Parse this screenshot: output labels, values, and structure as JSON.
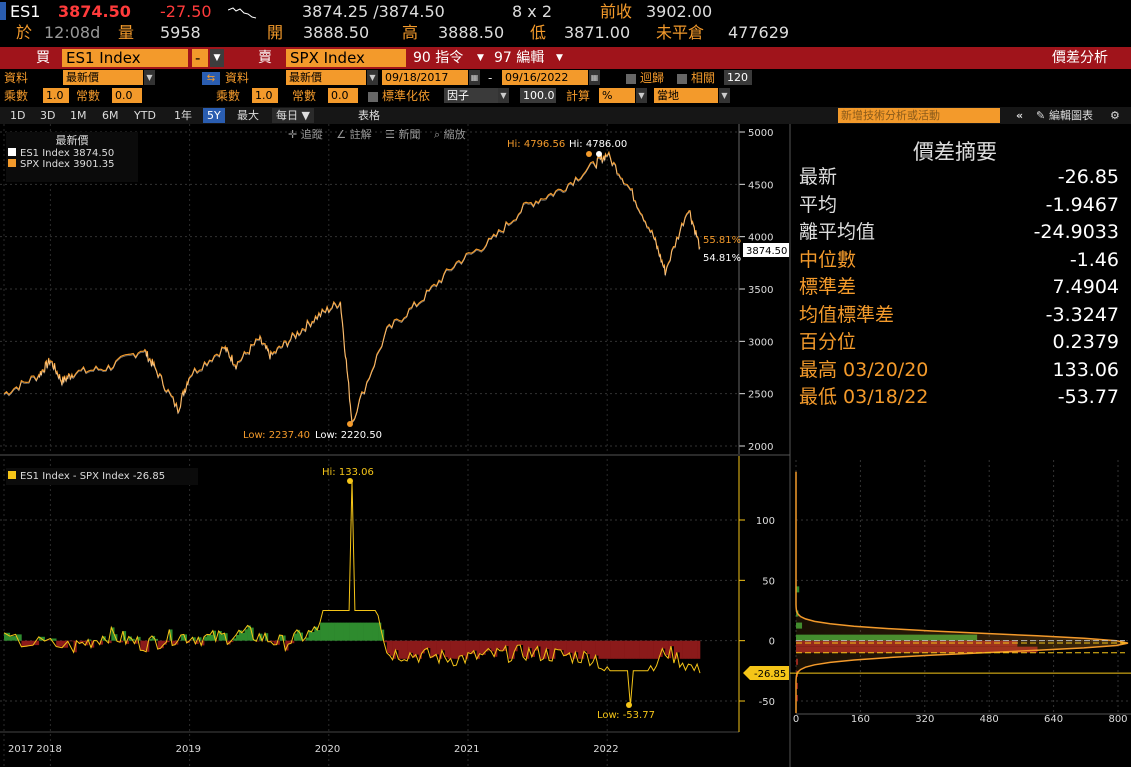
{
  "quote": {
    "ticker": "ES1",
    "last": "3874.50",
    "change": "-27.50",
    "bid_ask": "3874.25 /3874.50",
    "size": "8 x 2",
    "prev_close_label": "前收",
    "prev_close": "3902.00",
    "at_label": "於",
    "time": "12:08d",
    "volume_label": "量",
    "volume": "5958",
    "open_label": "開",
    "open": "3888.50",
    "high_label": "高",
    "high": "3888.50",
    "low_label": "低",
    "low": "3871.00",
    "oi_label": "未平倉",
    "open_interest": "477629"
  },
  "security_bar": {
    "buy_label": "買",
    "buy_security": "ES1 Index",
    "minus": "-",
    "sell_label": "賣",
    "sell_security": "SPX Index",
    "cmd1": "90 指令",
    "cmd2": "97 編輯",
    "title": "價差分析"
  },
  "controls": {
    "data_label": "資料",
    "data_value1": "最新價",
    "data_label2": "資料",
    "data_value2": "最新價",
    "start_date": "09/18/2017",
    "dash": "-",
    "end_date": "09/16/2022",
    "regression_label": "迴歸",
    "correlation_label": "相關",
    "correlation_value": "120",
    "mult_label": "乘數",
    "mult_value": "1.0",
    "const_label": "常數",
    "const_value": "0.0",
    "mult_label2": "乘數",
    "mult_value2": "1.0",
    "const_label2": "常數",
    "const_value2": "0.0",
    "normalize_label": "標準化依",
    "normalize_value": "因子",
    "normalize_num": "100.0",
    "calc_label": "計算",
    "calc_value": "%",
    "local_value": "當地"
  },
  "tabs": {
    "items": [
      "1D",
      "3D",
      "1M",
      "6M",
      "YTD",
      "1年",
      "5Y",
      "最大"
    ],
    "active": "5Y",
    "frequency": "每日 ▼",
    "table": "表格",
    "search_placeholder": "新增技術分析或活動",
    "edit_chart": "編輯圖表"
  },
  "chart_toolbar": {
    "track": "追蹤",
    "annotate": "註解",
    "news": "新聞",
    "zoom": "縮放"
  },
  "legend": {
    "title": "最新價",
    "series1": "ES1 Index  3874.50",
    "series2": "SPX Index  3901.35",
    "spread": "ES1 Index - SPX Index  -26.85"
  },
  "chart_data": [
    {
      "type": "line",
      "series": [
        {
          "name": "ES1 Index",
          "color": "#ffffff",
          "last": 3874.5
        },
        {
          "name": "SPX Index",
          "color": "#f39a2b",
          "last": 3901.35
        }
      ],
      "x": [
        "2017-09",
        "2017-12",
        "2018-01",
        "2018-02",
        "2018-03",
        "2018-06",
        "2018-09",
        "2018-10",
        "2018-12",
        "2019-01",
        "2019-04",
        "2019-05",
        "2019-07",
        "2019-08",
        "2019-10",
        "2019-12",
        "2020-02",
        "2020-03",
        "2020-06",
        "2020-09",
        "2020-12",
        "2021-03",
        "2021-06",
        "2021-09",
        "2021-12",
        "2022-01",
        "2022-03",
        "2022-05",
        "2022-06",
        "2022-08",
        "2022-09"
      ],
      "values": [
        2500,
        2680,
        2820,
        2620,
        2700,
        2750,
        2930,
        2750,
        2350,
        2680,
        2940,
        2780,
        3020,
        2860,
        3050,
        3240,
        3380,
        2240,
        3100,
        3400,
        3750,
        3960,
        4300,
        4450,
        4700,
        4790,
        4450,
        4000,
        3670,
        4280,
        3901
      ],
      "ylim": [
        2000,
        5000
      ],
      "yticks": [
        2000,
        2500,
        3000,
        3500,
        4000,
        4500,
        5000
      ],
      "annotations": {
        "hi1": "Hi: 4796.56",
        "hi2": "Hi: 4786.00",
        "low1": "Low: 2237.40",
        "low2": "Low: 2220.50",
        "pct1": "55.81%",
        "pct2": "54.81%",
        "last_label": "3874.50"
      }
    },
    {
      "type": "line",
      "series": [
        {
          "name": "ES1 Index - SPX Index",
          "color": "#f5c518",
          "last": -26.85
        }
      ],
      "x": [
        "2017-09",
        "2018-03",
        "2018-06",
        "2018-09",
        "2018-12",
        "2019-03",
        "2019-06",
        "2019-09",
        "2019-12",
        "2020-03",
        "2020-06",
        "2020-09",
        "2020-12",
        "2021-03",
        "2021-06",
        "2021-09",
        "2021-12",
        "2022-03",
        "2022-06",
        "2022-09"
      ],
      "values": [
        0,
        -5,
        5,
        -3,
        4,
        2,
        6,
        -2,
        8,
        133.06,
        -10,
        -12,
        -15,
        -12,
        -10,
        -12,
        -14,
        -53.77,
        -8,
        -26.85
      ],
      "ylim": [
        -60,
        140
      ],
      "yticks": [
        -50,
        0,
        50,
        100
      ],
      "annotations": {
        "hi": "Hi: 133.06",
        "low": "Low: -53.77",
        "last_label": "-26.85"
      },
      "xticks": [
        "2017",
        "2018",
        "2019",
        "2020",
        "2021",
        "2022"
      ]
    },
    {
      "type": "bar",
      "orientation": "horizontal",
      "title": "",
      "categories": [
        "40",
        "20",
        "10",
        "0",
        "-5",
        "-10",
        "-20",
        "-30",
        "-40",
        "-50"
      ],
      "values": [
        8,
        6,
        15,
        450,
        550,
        600,
        5,
        3,
        2,
        1
      ],
      "xticks": [
        0,
        160,
        320,
        480,
        640,
        800
      ],
      "xlim": [
        0,
        800
      ]
    }
  ],
  "stats": {
    "title": "價差摘要",
    "rows": [
      {
        "label": "最新",
        "value": "-26.85",
        "color": "#dddddd"
      },
      {
        "label": "平均",
        "value": "-1.9467",
        "color": "#dddddd"
      },
      {
        "label": "離平均值",
        "value": "-24.9033",
        "color": "#dddddd"
      },
      {
        "label": "中位數",
        "value": "-1.46",
        "color": "#f39a2b"
      },
      {
        "label": "標準差",
        "value": "7.4904",
        "color": "#f39a2b"
      },
      {
        "label": "均值標準差",
        "value": "-3.3247",
        "color": "#f39a2b"
      },
      {
        "label": "百分位",
        "value": "0.2379",
        "color": "#f39a2b"
      },
      {
        "label": "最高 03/20/20",
        "value": "133.06",
        "color": "#f39a2b"
      },
      {
        "label": "最低 03/18/22",
        "value": "-53.77",
        "color": "#f39a2b"
      }
    ]
  },
  "colors": {
    "accent": "#f39a2b",
    "bar": "#a0141b",
    "spread_line": "#f5c518",
    "positive_fill": "#2e8b2e",
    "negative_fill": "#8b1a1a"
  }
}
